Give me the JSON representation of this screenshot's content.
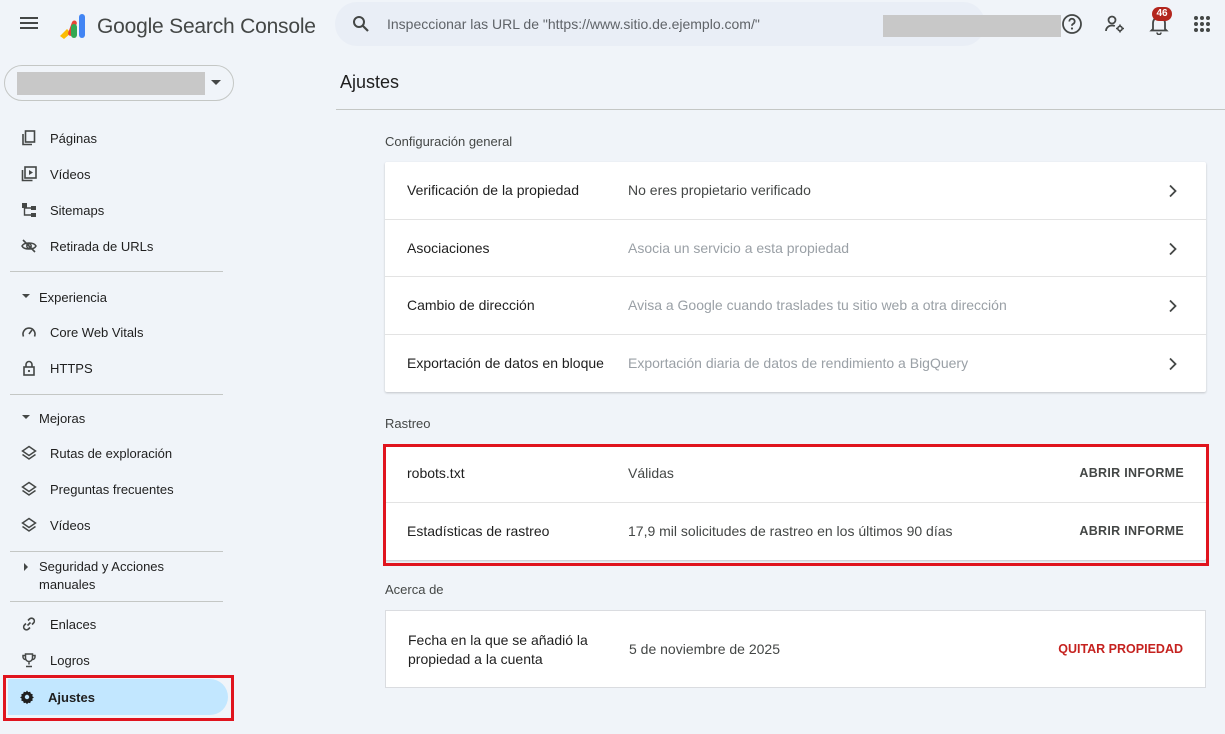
{
  "app": {
    "brand": "Google Search Console"
  },
  "search": {
    "placeholder": "Inspeccionar las URL de \"https://www.sitio.de.ejemplo.com/\""
  },
  "header": {
    "notifications_count": "46"
  },
  "sidebar": {
    "items_top": [
      {
        "label": "Páginas",
        "icon": "pages-icon"
      },
      {
        "label": "Vídeos",
        "icon": "video-icon"
      },
      {
        "label": "Sitemaps",
        "icon": "sitemap-icon"
      },
      {
        "label": "Retirada de URLs",
        "icon": "eye-off-icon"
      }
    ],
    "experiencia": {
      "title": "Experiencia",
      "items": [
        {
          "label": "Core Web Vitals"
        },
        {
          "label": "HTTPS"
        }
      ]
    },
    "mejoras": {
      "title": "Mejoras",
      "items": [
        {
          "label": "Rutas de exploración"
        },
        {
          "label": "Preguntas frecuentes"
        },
        {
          "label": "Vídeos"
        }
      ]
    },
    "seguridad": {
      "title": "Seguridad y Acciones manuales"
    },
    "items_bottom": [
      {
        "label": "Enlaces"
      },
      {
        "label": "Logros"
      },
      {
        "label": "Ajustes"
      }
    ]
  },
  "main": {
    "title": "Ajustes",
    "general": {
      "title": "Configuración general",
      "rows": [
        {
          "label": "Verificación de la propiedad",
          "value": "No eres propietario verificado"
        },
        {
          "label": "Asociaciones",
          "value": "Asocia un servicio a esta propiedad"
        },
        {
          "label": "Cambio de dirección",
          "value": "Avisa a Google cuando traslades tu sitio web a otra dirección"
        },
        {
          "label": "Exportación de datos en bloque",
          "value": "Exportación diaria de datos de rendimiento a BigQuery"
        }
      ]
    },
    "crawl": {
      "title": "Rastreo",
      "rows": [
        {
          "label": "robots.txt",
          "value": "Válidas",
          "action": "ABRIR INFORME"
        },
        {
          "label": "Estadísticas de rastreo",
          "value": "17,9 mil solicitudes de rastreo en los últimos 90 días",
          "action": "ABRIR INFORME"
        }
      ]
    },
    "about": {
      "title": "Acerca de",
      "label": "Fecha en la que se añadió la propiedad a la cuenta",
      "value": "5 de noviembre de 2025",
      "action": "QUITAR PROPIEDAD"
    }
  },
  "colors": {
    "highlight": "#e0141e",
    "active_bg": "#c2e7ff",
    "danger": "#c5221f"
  }
}
